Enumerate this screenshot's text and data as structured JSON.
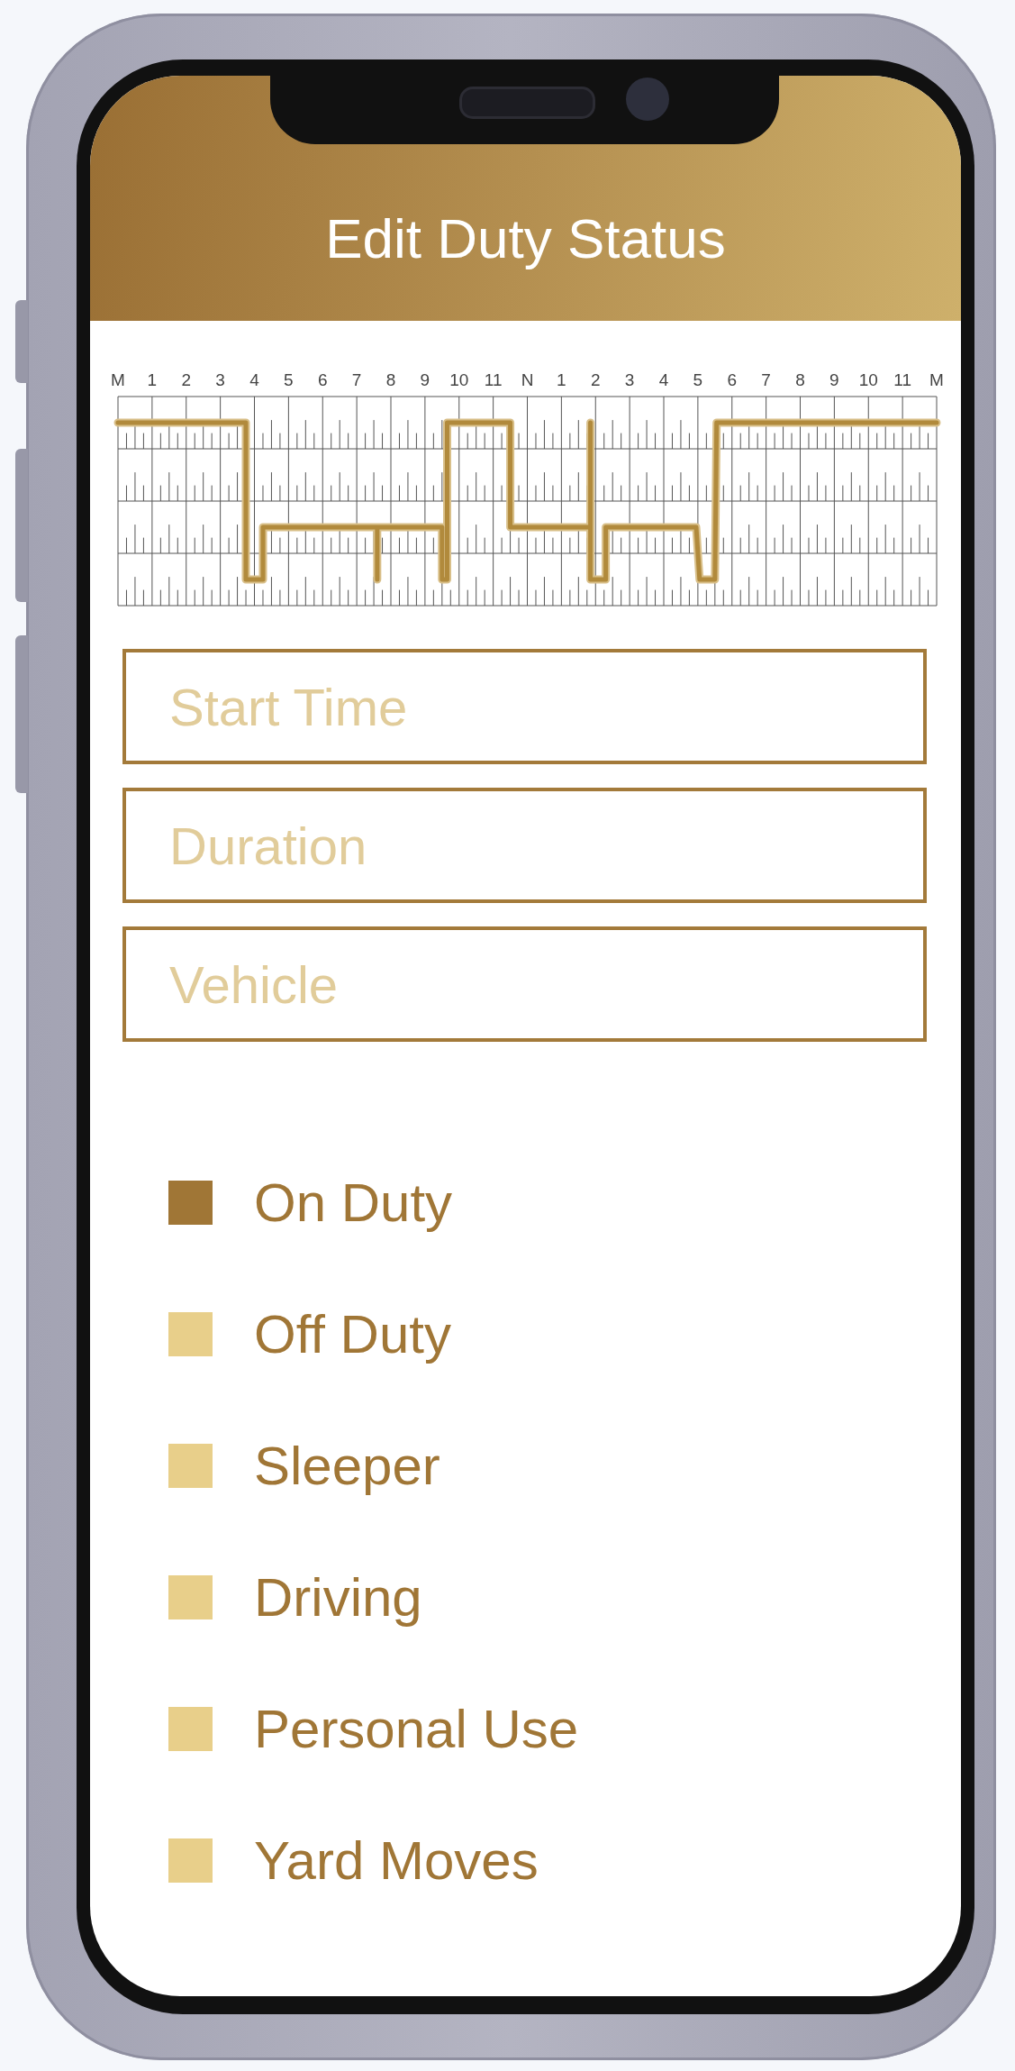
{
  "header": {
    "title": "Edit Duty Status"
  },
  "log_graph": {
    "hour_labels": [
      "M",
      "1",
      "2",
      "3",
      "4",
      "5",
      "6",
      "7",
      "8",
      "9",
      "10",
      "11",
      "N",
      "1",
      "2",
      "3",
      "4",
      "5",
      "6",
      "7",
      "8",
      "9",
      "10",
      "11",
      "M"
    ]
  },
  "fields": [
    {
      "placeholder": "Start Time"
    },
    {
      "placeholder": "Duration"
    },
    {
      "placeholder": "Vehicle"
    }
  ],
  "statuses": [
    {
      "label": "On Duty",
      "selected": true
    },
    {
      "label": "Off Duty",
      "selected": false
    },
    {
      "label": "Sleeper",
      "selected": false
    },
    {
      "label": "Driving",
      "selected": false
    },
    {
      "label": "Personal Use",
      "selected": false
    },
    {
      "label": "Yard Moves",
      "selected": false
    }
  ]
}
